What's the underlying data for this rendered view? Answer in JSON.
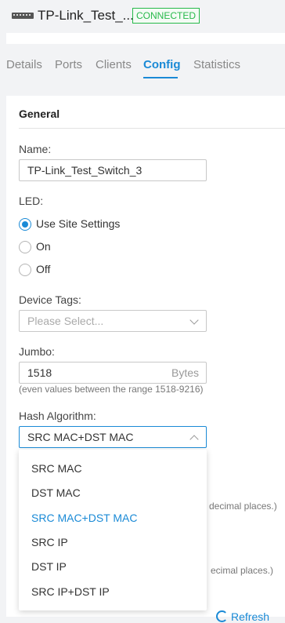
{
  "device": {
    "name": "TP-Link_Test_...",
    "status": "CONNECTED"
  },
  "tabs": [
    {
      "label": "Details"
    },
    {
      "label": "Ports"
    },
    {
      "label": "Clients"
    },
    {
      "label": "Config",
      "active": true
    },
    {
      "label": "Statistics"
    }
  ],
  "general": {
    "section_title": "General",
    "name_label": "Name:",
    "name_value": "TP-Link_Test_Switch_3",
    "led_label": "LED:",
    "led_options": [
      {
        "label": "Use Site Settings",
        "checked": true
      },
      {
        "label": "On",
        "checked": false
      },
      {
        "label": "Off",
        "checked": false
      }
    ],
    "device_tags_label": "Device Tags:",
    "device_tags_placeholder": "Please Select...",
    "jumbo_label": "Jumbo:",
    "jumbo_value": "1518",
    "jumbo_unit": "Bytes",
    "jumbo_hint": "(even values between the range 1518-9216)",
    "hash_label": "Hash Algorithm:",
    "hash_value": "SRC MAC+DST MAC",
    "hash_options": [
      "SRC MAC",
      "DST MAC",
      "SRC MAC+DST MAC",
      "SRC IP",
      "DST IP",
      "SRC IP+DST IP"
    ],
    "hash_selected_index": 2,
    "partial_hint_1": "decimal places.)",
    "partial_hint_2": "ecimal places.)",
    "refresh_label": "Refresh"
  },
  "colors": {
    "accent": "#1a8ad6",
    "connected": "#27b94a"
  }
}
